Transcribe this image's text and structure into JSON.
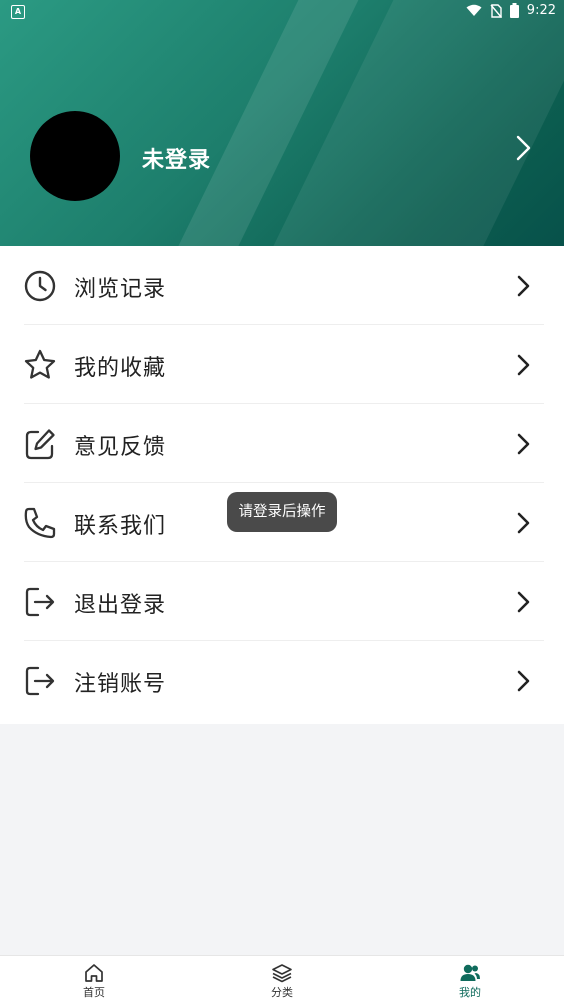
{
  "status_bar": {
    "time": "9:22"
  },
  "profile": {
    "username": "未登录"
  },
  "menu": [
    {
      "label": "浏览记录",
      "icon": "clock-icon"
    },
    {
      "label": "我的收藏",
      "icon": "star-icon"
    },
    {
      "label": "意见反馈",
      "icon": "edit-icon"
    },
    {
      "label": "联系我们",
      "icon": "phone-icon"
    },
    {
      "label": "退出登录",
      "icon": "logout-icon"
    },
    {
      "label": "注销账号",
      "icon": "logout-icon"
    }
  ],
  "toast": {
    "text": "请登录后操作"
  },
  "bottom_nav": [
    {
      "label": "首页",
      "icon": "home-icon"
    },
    {
      "label": "分类",
      "icon": "layers-icon"
    },
    {
      "label": "我的",
      "icon": "users-icon",
      "active": true
    }
  ],
  "colors": {
    "accent": "#0f6b5c",
    "header_start": "#2b9a83",
    "header_end": "#07514a"
  }
}
